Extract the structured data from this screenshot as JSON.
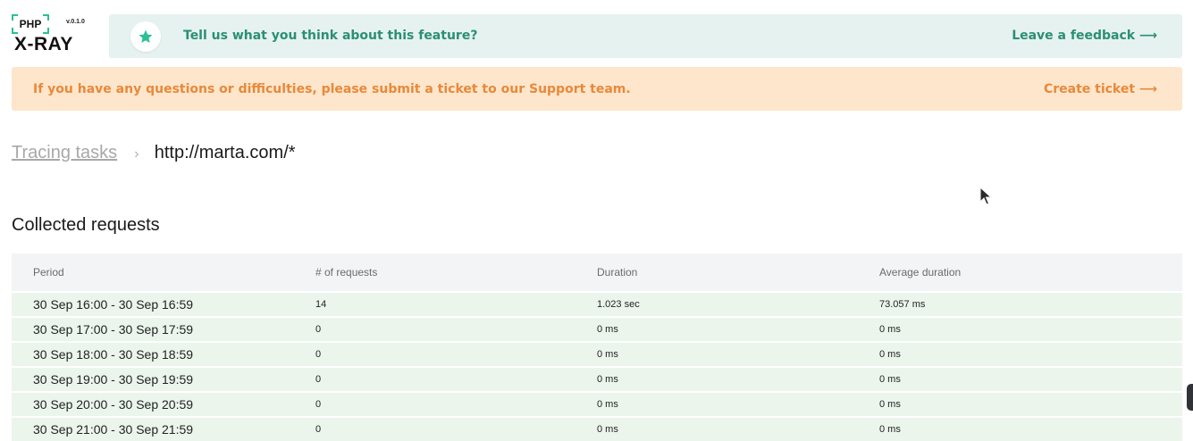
{
  "logo": {
    "php_text": "PHP",
    "version": "v.0.1.0",
    "name": "X-RAY"
  },
  "feedback_banner": {
    "message": "Tell us what you think about this feature?",
    "link_label": "Leave a feedback ⟶",
    "icon": "star-icon",
    "color": "#2a8f75"
  },
  "support_banner": {
    "message": "If you have any questions or difficulties, please submit a ticket to our Support team.",
    "link_label": "Create ticket ⟶",
    "color": "#e8893a"
  },
  "breadcrumb": {
    "parent": "Tracing tasks",
    "separator": "›",
    "current": "http://marta.com/*"
  },
  "section": {
    "title": "Collected requests"
  },
  "table": {
    "columns": [
      "Period",
      "# of requests",
      "Duration",
      "Average duration"
    ],
    "rows": [
      [
        "30 Sep 16:00 - 30 Sep 16:59",
        "14",
        "1.023 sec",
        "73.057 ms"
      ],
      [
        "30 Sep 17:00 - 30 Sep 17:59",
        "0",
        "0 ms",
        "0 ms"
      ],
      [
        "30 Sep 18:00 - 30 Sep 18:59",
        "0",
        "0 ms",
        "0 ms"
      ],
      [
        "30 Sep 19:00 - 30 Sep 19:59",
        "0",
        "0 ms",
        "0 ms"
      ],
      [
        "30 Sep 20:00 - 30 Sep 20:59",
        "0",
        "0 ms",
        "0 ms"
      ],
      [
        "30 Sep 21:00 - 30 Sep 21:59",
        "0",
        "0 ms",
        "0 ms"
      ]
    ]
  }
}
